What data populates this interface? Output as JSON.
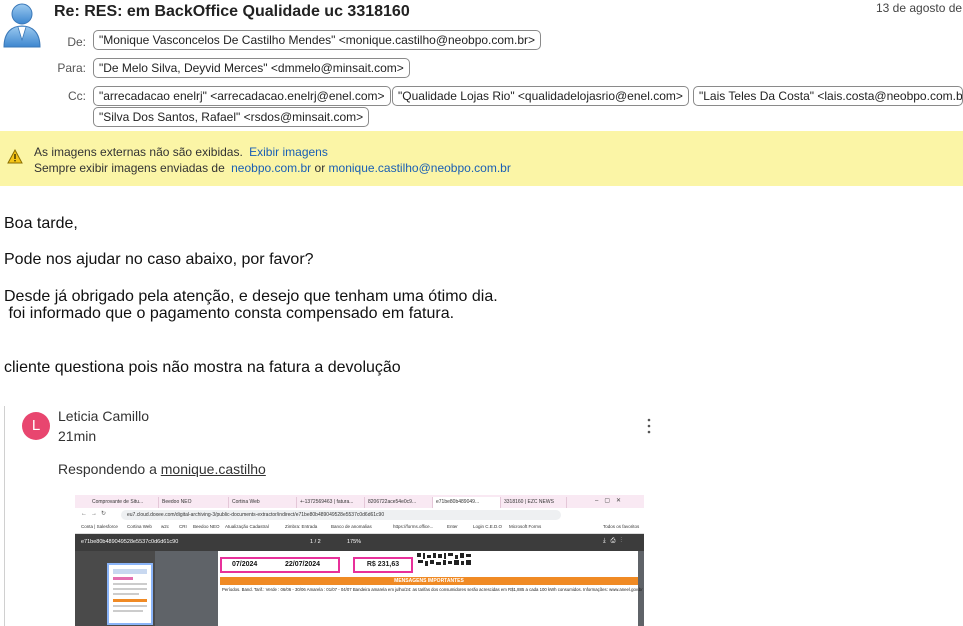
{
  "header": {
    "subject": "Re: RES: em BackOffice Qualidade uc 3318160",
    "date": "13 de agosto de"
  },
  "fields": {
    "from_label": "De:",
    "to_label": "Para:",
    "cc_label": "Cc:",
    "from": [
      "\"Monique Vasconcelos De Castilho Mendes\" <monique.castilho@neobpo.com.br>"
    ],
    "to": [
      "\"De Melo Silva, Deyvid Merces\" <dmmelo@minsait.com>"
    ],
    "cc": [
      "\"arrecadacao enelrj\" <arrecadacao.enelrj@enel.com>",
      "\"Qualidade Lojas Rio\" <qualidadelojasrio@enel.com>",
      "\"Lais Teles Da Costa\" <lais.costa@neobpo.com.br>",
      "\"Silva Dos Santos, Rafael\" <rsdos@minsait.com>"
    ]
  },
  "banner": {
    "line1": "As imagens externas não são exibidas.",
    "show_images": "Exibir imagens",
    "line2_prefix": "Sempre exibir imagens enviadas de",
    "domain": "neobpo.com.br",
    "or": "or",
    "email": "monique.castilho@neobpo.com.br"
  },
  "body": {
    "lines": [
      "Boa tarde,",
      "Pode nos ajudar no caso abaixo, por favor?",
      "Desde já obrigado pela atenção, e desejo que tenham uma ótimo dia.",
      " foi informado que o pagamento consta compensado em fatura.",
      "cliente questiona pois não mostra na fatura a devolução"
    ]
  },
  "quoted": {
    "avatar_letter": "L",
    "avatar_color": "#e8466f",
    "name": "Leticia Camillo",
    "time": "21min",
    "reply_prefix": "Respondendo a",
    "reply_to": "monique.castilho"
  },
  "screenshot": {
    "tabs": [
      "Comprovante de Situ...",
      "Beedoo NEO",
      "Cortina Web",
      "+-1372569463 | fatura...",
      "8206722ace54e0c9...",
      "e71be80b489049...",
      "3318160 | EZC NEWS"
    ],
    "address": "eu7.cloud.doxee.com/digital-archiving-3/public-documents-extractor/indirect/e71be80b489049528e5537c0d6d61c90",
    "bookmarks": [
      "Conta | Salesforce",
      "Cortina Web",
      "w2c",
      "CRI",
      "Beedoo NEO",
      "Atualização Cadastral",
      "Zimbra: Entrada",
      "Banco de anomalias",
      "https://forms.office...",
      "Enter",
      "Login C.E.D.O",
      "Microsoft Forms",
      "Todos os favoritos"
    ],
    "pdf_title": "e71be80b489049528e5537c0d6d61c90",
    "page_indicator": "1 / 2",
    "zoom": "175%",
    "month": "07/2024",
    "due_date": "22/07/2024",
    "amount": "R$ 231,63",
    "important_header": "MENSAGENS IMPORTANTES",
    "important_text": "Períodos. Band. Tarif.: Verde : 06/06 - 30/06 Amarela : 01/07 - 04/07 Bandeira amarela em julho/24: as tarifas dos consumidores serão acrescidas em R$1,885 a cada 100 kWh consumidos. Informações: www.aneel.gov.br"
  }
}
